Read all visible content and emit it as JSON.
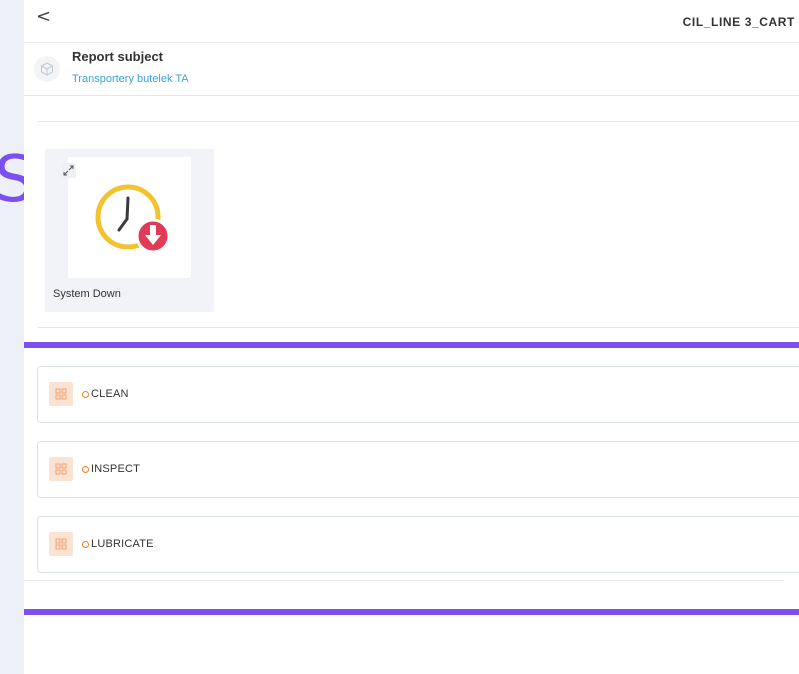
{
  "header": {
    "back_glyph": "<",
    "title": "CIL_LINE 3_CART"
  },
  "background": {
    "glyph": "S"
  },
  "subject": {
    "label": "Report subject",
    "value": "Transportery butelek TA",
    "icon": "cube-icon"
  },
  "card": {
    "label": "System Down",
    "icon": "clock-down-icon",
    "expand_icon": "expand-icon"
  },
  "actions": [
    {
      "label": "CLEAN",
      "icon": "grid-icon"
    },
    {
      "label": "INSPECT",
      "icon": "grid-icon"
    },
    {
      "label": "LUBRICATE",
      "icon": "grid-icon"
    }
  ],
  "colors": {
    "accent_purple": "#7b4ff0",
    "link_blue": "#3aa3d8",
    "clock_gold": "#f2c230",
    "alert_red": "#e23b57",
    "action_orange": "#f0821e",
    "action_icon_bg": "#fbe3d3"
  }
}
